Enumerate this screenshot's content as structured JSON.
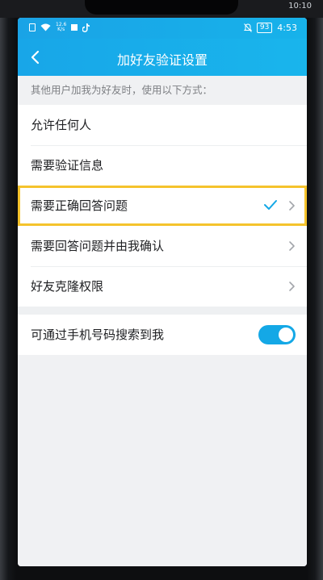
{
  "device": {
    "outer_time": "10:10"
  },
  "status_bar": {
    "speed": "12.6",
    "speed_unit": "K/s",
    "battery": "93",
    "time": "4:53"
  },
  "nav": {
    "title": "加好友验证设置",
    "back_icon": "chevron-left-icon"
  },
  "section": {
    "header": "其他用户加我为好友时，使用以下方式："
  },
  "options": [
    {
      "label": "允许任何人",
      "selected": false,
      "has_arrow": false
    },
    {
      "label": "需要验证信息",
      "selected": false,
      "has_arrow": false
    },
    {
      "label": "需要正确回答问题",
      "selected": true,
      "has_arrow": true
    },
    {
      "label": "需要回答问题并由我确认",
      "selected": false,
      "has_arrow": true
    },
    {
      "label": "好友克隆权限",
      "selected": false,
      "has_arrow": true
    }
  ],
  "phone_search": {
    "label": "可通过手机号码搜索到我",
    "enabled": true
  },
  "colors": {
    "accent": "#14a8e6",
    "highlight": "#f5c32c"
  }
}
